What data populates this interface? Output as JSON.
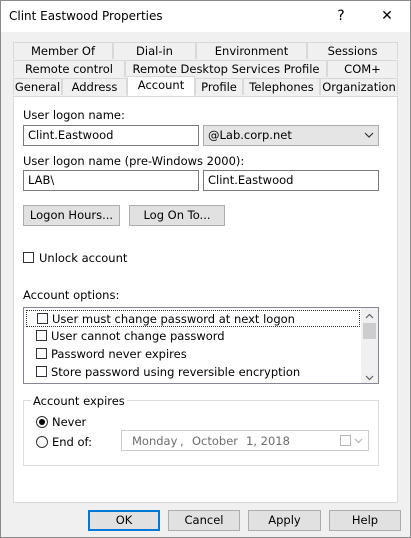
{
  "window": {
    "title": "Clint Eastwood Properties",
    "help_label": "?",
    "close_label": "✕"
  },
  "tabs": {
    "row1": [
      "Member Of",
      "Dial-in",
      "Environment",
      "Sessions"
    ],
    "row2": [
      "Remote control",
      "Remote Desktop Services Profile",
      "COM+"
    ],
    "row3": [
      "General",
      "Address",
      "Account",
      "Profile",
      "Telephones",
      "Organization"
    ],
    "active": "Account"
  },
  "account": {
    "logon_name_label": "User logon name:",
    "logon_name_value": "Clint.Eastwood",
    "domain_value": "@Lab.corp.net",
    "pre2000_label": "User logon name (pre-Windows 2000):",
    "pre2000_domain": "LAB\\",
    "pre2000_name": "Clint.Eastwood",
    "logon_hours_button": "Logon Hours...",
    "log_on_to_button": "Log On To...",
    "unlock_label": "Unlock account",
    "options_label": "Account options:",
    "options": [
      "User must change password at next logon",
      "User cannot change password",
      "Password never expires",
      "Store password using reversible encryption"
    ],
    "expires_label": "Account expires",
    "never_label": "Never",
    "end_of_label": "End of:",
    "date_day": "Monday",
    "date_sep1": ",",
    "date_month": "October",
    "date_rest": "1, 2018",
    "expires_selected": "Never"
  },
  "footer": {
    "ok": "OK",
    "cancel": "Cancel",
    "apply": "Apply",
    "help": "Help"
  }
}
